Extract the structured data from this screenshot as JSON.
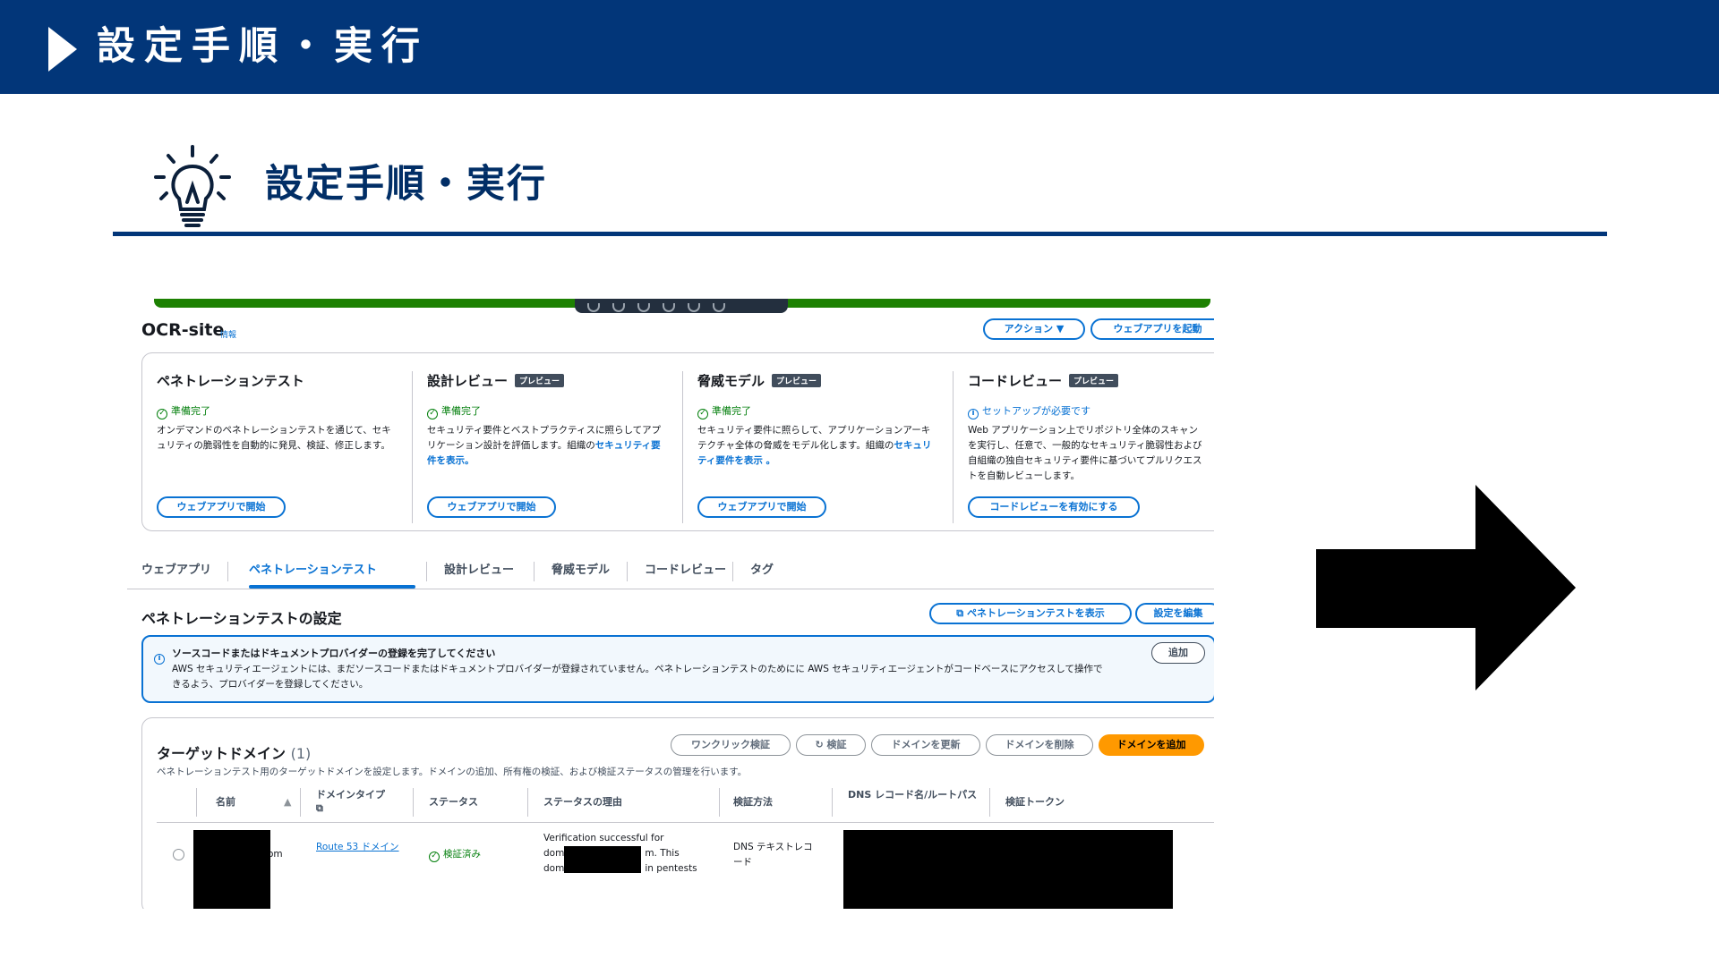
{
  "banner": {
    "title": "設定手順・実行"
  },
  "heading": {
    "title": "設定手順・実行"
  },
  "screenshot": {
    "site_title": "OCR-site",
    "info_link": "情報",
    "actions_button": "アクション ▼",
    "launch_webapp_button": "ウェブアプリを起動",
    "cards": [
      {
        "title": "ペネトレーションテスト",
        "badge": "",
        "status": "準備完了",
        "status_type": "ok",
        "desc": "オンデマンドのペネトレーションテストを通じて、セキュリティの脆弱性を自動的に発見、検証、修正します。",
        "link": "",
        "button": "ウェブアプリで開始"
      },
      {
        "title": "設計レビュー",
        "badge": "プレビュー",
        "status": "準備完了",
        "status_type": "ok",
        "desc": "セキュリティ要件とベストプラクティスに照らしてアプリケーション設計を評価します。組織の",
        "link": "セキュリティ要件を表示。",
        "button": "ウェブアプリで開始"
      },
      {
        "title": "脅威モデル",
        "badge": "プレビュー",
        "status": "準備完了",
        "status_type": "ok",
        "desc": "セキュリティ要件に照らして、アプリケーションアーキテクチャ全体の脅威をモデル化します。組織の",
        "link": "セキュリティ要件を表示 。",
        "button": "ウェブアプリで開始"
      },
      {
        "title": "コードレビュー",
        "badge": "プレビュー",
        "status": "セットアップが必要です",
        "status_type": "info",
        "desc": "Web アプリケーション上でリポジトリ全体のスキャンを実行し、任意で、一般的なセキュリティ脆弱性および自組織の独自セキュリティ要件に基づいてプルリクエストを自動レビューします。",
        "link": "",
        "button": "コードレビューを有効にする"
      }
    ],
    "tabs": [
      "ウェブアプリ",
      "ペネトレーションテスト",
      "設計レビュー",
      "脅威モデル",
      "コードレビュー",
      "タグ"
    ],
    "section_title": "ペネトレーションテストの設定",
    "view_pentest_button": "ペネトレーションテストを表示",
    "edit_settings_button": "設定を編集",
    "alert": {
      "title": "ソースコードまたはドキュメントプロバイダーの登録を完了してください",
      "body": "AWS セキュリティエージェントには、まだソースコードまたはドキュメントプロバイダーが登録されていません。ペネトレーションテストのためにに AWS セキュリティエージェントがコードベースにアクセスして操作できるよう、プロバイダーを登録してください。",
      "button": "追加"
    },
    "target_domains": {
      "title": "ターゲットドメイン",
      "count": "(1)",
      "subtitle": "ペネトレーションテスト用のターゲットドメインを設定します。ドメインの追加、所有権の検証、および検証ステータスの管理を行います。",
      "buttons": {
        "one_click_verify": "ワンクリック検証",
        "verify": "検証",
        "update_domain": "ドメインを更新",
        "delete_domain": "ドメインを削除",
        "add_domain": "ドメインを追加"
      },
      "columns": [
        "名前",
        "ドメインタイプ",
        "ステータス",
        "ステータスの理由",
        "検証方法",
        "DNS レコード名/ルートパス",
        "検証トークン"
      ],
      "row": {
        "name_suffix": "om",
        "domain_type": "Route 53 ドメイン",
        "status": "検証済み",
        "reason_l1": "Verification successful for",
        "reason_l2a": "dom",
        "reason_l2b": "m. This",
        "reason_l3a": "dom",
        "reason_l3b": "in pentests",
        "method": "DNS テキストレコード"
      }
    }
  },
  "colors": {
    "banner": "#023679",
    "link": "#0972d3",
    "ok": "#037f0c",
    "primary_button": "#ff9900"
  }
}
